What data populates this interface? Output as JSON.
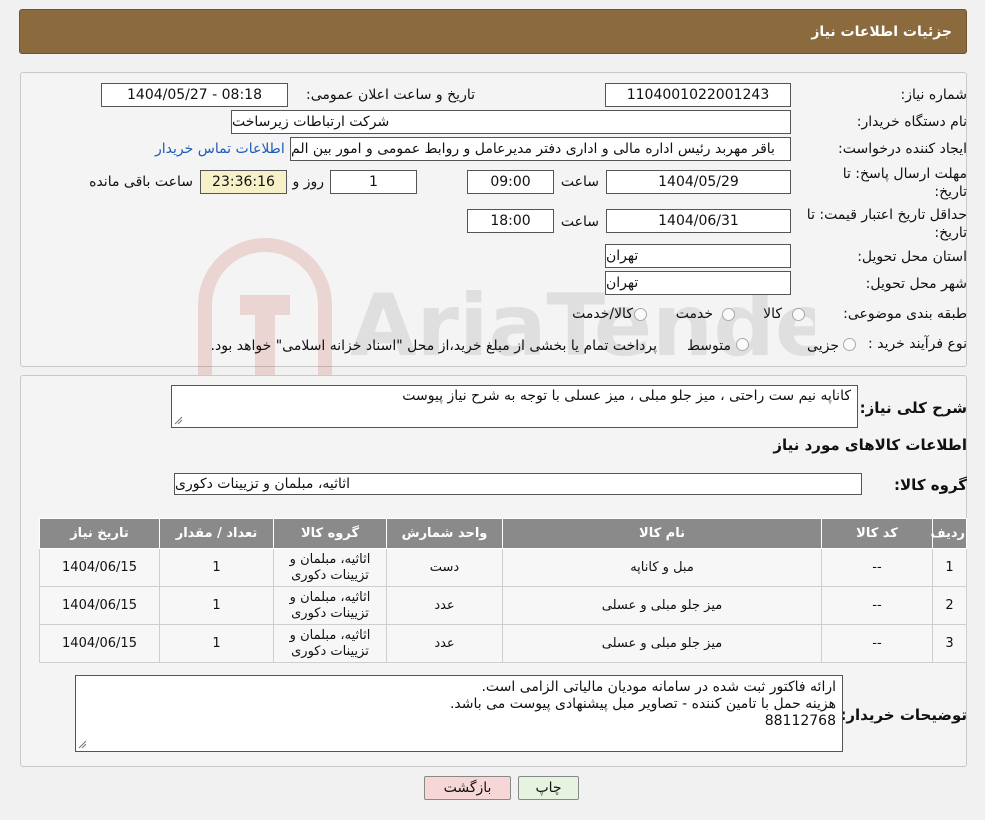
{
  "header": {
    "title": "جزئیات اطلاعات نیاز"
  },
  "form": {
    "need_number_label": "شماره نیاز:",
    "need_number": "1104001022001243",
    "announce_label": "تاریخ و ساعت اعلان عمومی:",
    "announce_value": "1404/05/27 - 08:18",
    "buyer_org_label": "نام دستگاه خریدار:",
    "buyer_org": "شرکت ارتباطات زیرساخت",
    "requester_label": "ایجاد کننده درخواست:",
    "requester": "باقر مهربد رئیس اداره مالی و اداری دفتر مدیرعامل و روابط عمومی و امور بین الم",
    "contact_link": "اطلاعات تماس خریدار",
    "reply_deadline_label_1": "مهلت ارسال پاسخ: تا",
    "reply_deadline_label_2": "تاریخ:",
    "reply_date": "1404/05/29",
    "time_label": "ساعت",
    "reply_time": "09:00",
    "days_value": "1",
    "days_label": "روز و",
    "remaining_time": "23:36:16",
    "remaining_label": "ساعت باقی مانده",
    "price_validity_label_1": "حداقل تاریخ اعتبار قیمت: تا",
    "price_validity_label_2": "تاریخ:",
    "price_date": "1404/06/31",
    "price_time_label": "ساعت",
    "price_time": "18:00",
    "province_label": "استان محل تحویل:",
    "province": "تهران",
    "city_label": "شهر محل تحویل:",
    "city": "تهران",
    "category_label": "طبقه بندی موضوعی:",
    "category_options": [
      "کالا",
      "خدمت",
      "کالا/خدمت"
    ],
    "process_label": "نوع فرآیند خرید :",
    "process_options": [
      "جزیی",
      "متوسط"
    ],
    "process_note": "پرداخت تمام یا بخشی از مبلغ خرید،از محل \"اسناد خزانه اسلامی\" خواهد بود."
  },
  "description": {
    "label": "شرح کلی نیاز:",
    "text": "کاناپه نیم ست راحتی ، میز جلو مبلی ، میز عسلی با توجه به شرح نیاز پیوست"
  },
  "goods_section": {
    "title": "اطلاعات کالاهای مورد نیاز",
    "group_label": "گروه کالا:",
    "group_value": "اثاثیه، مبلمان و تزیینات دکوری"
  },
  "table": {
    "headers": [
      "ردیف",
      "کد کالا",
      "نام کالا",
      "واحد شمارش",
      "گروه کالا",
      "تعداد / مقدار",
      "تاریخ نیاز"
    ],
    "rows": [
      [
        "1",
        "--",
        "مبل و کاناپه",
        "دست",
        "اثاثیه، مبلمان و تزیینات دکوری",
        "1",
        "1404/06/15"
      ],
      [
        "2",
        "--",
        "میز جلو مبلی و عسلی",
        "عدد",
        "اثاثیه، مبلمان و تزیینات دکوری",
        "1",
        "1404/06/15"
      ],
      [
        "3",
        "--",
        "میز جلو مبلی و عسلی",
        "عدد",
        "اثاثیه، مبلمان و تزیینات دکوری",
        "1",
        "1404/06/15"
      ]
    ]
  },
  "buyer_notes": {
    "label": "توضیحات خریدار:",
    "lines": [
      "ارائه فاکتور ثبت شده در سامانه مودیان مالیاتی الزامی است.",
      "هزینه حمل با تامین کننده - تصاویر مبل پیشنهادی پیوست می باشد.",
      "88112768"
    ]
  },
  "buttons": {
    "print": "چاپ",
    "back": "بازگشت"
  },
  "watermark": {
    "text": "AriaTender.neT"
  },
  "colors": {
    "title_bar": "#8b6a3d",
    "link": "#1e5bb8",
    "table_header": "#8a8a8a",
    "back_button": "#f6d6d6",
    "print_button": "#e6f3df"
  }
}
